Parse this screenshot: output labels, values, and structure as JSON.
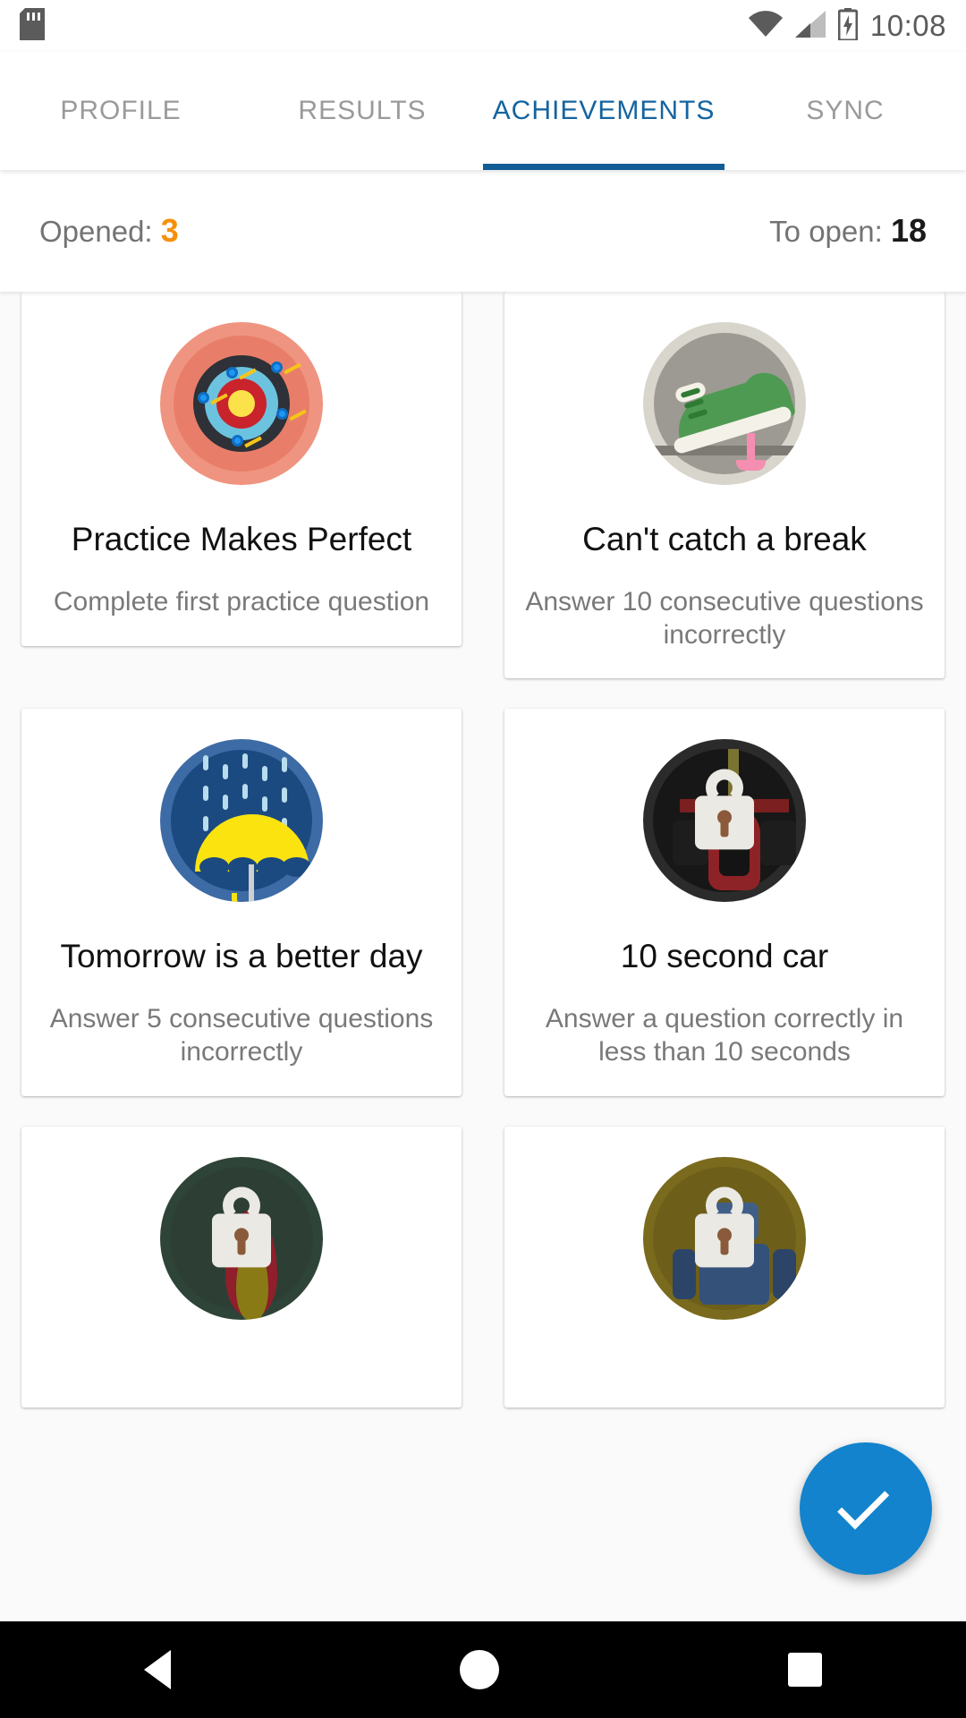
{
  "status_bar": {
    "sdcard_icon": "sdcard-icon",
    "wifi_icon": "wifi-icon",
    "signal_icon": "cellular-signal-icon",
    "battery_icon": "battery-charging-icon",
    "time": "10:08"
  },
  "tabs": [
    {
      "label": "PROFILE",
      "active": false
    },
    {
      "label": "RESULTS",
      "active": false
    },
    {
      "label": "ACHIEVEMENTS",
      "active": true
    },
    {
      "label": "SYNC",
      "active": false
    }
  ],
  "stats": {
    "opened_label": "Opened:",
    "opened_value": "3",
    "to_open_label": "To open:",
    "to_open_value": "18",
    "opened_color": "#f5900c",
    "to_open_color": "#1a1a1a"
  },
  "achievements": [
    {
      "title": "Practice Makes Perfect",
      "description": "Complete first practice question",
      "icon": "archery-target-icon",
      "locked": false
    },
    {
      "title": "Can't catch a break",
      "description": "Answer 10 consecutive questions incorrectly",
      "icon": "sneaker-gum-icon",
      "locked": false
    },
    {
      "title": "Tomorrow is a better day",
      "description": "Answer 5 consecutive questions incorrectly",
      "icon": "umbrella-rain-icon",
      "locked": false
    },
    {
      "title": "10 second car",
      "description": "Answer a question correctly in less than 10 seconds",
      "icon": "race-car-icon",
      "locked": true
    },
    {
      "title": "",
      "description": "",
      "icon": "flame-icon",
      "locked": true
    },
    {
      "title": "",
      "description": "",
      "icon": "robot-icon",
      "locked": true
    }
  ],
  "fab": {
    "icon": "check-icon",
    "color": "#1283cc"
  },
  "nav_bar": {
    "back": "back-icon",
    "home": "home-icon",
    "recents": "recents-icon"
  }
}
